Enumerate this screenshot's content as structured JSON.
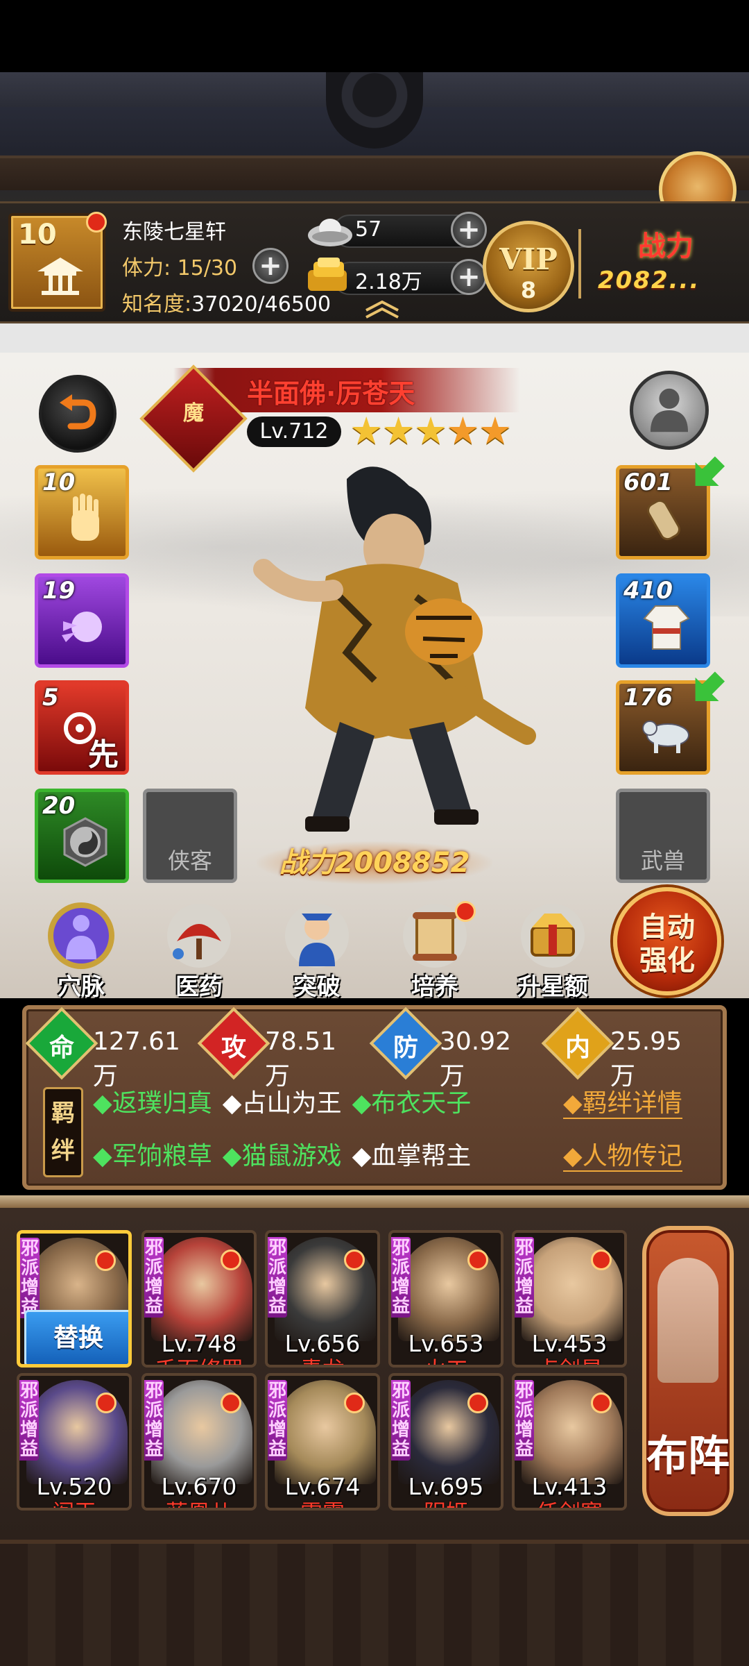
{
  "player": {
    "level": "10",
    "name": "东陵七星轩",
    "stamina_label": "体力: 15/30",
    "fame_label": "知名度:",
    "fame_value": "37020/46500",
    "silver": "57",
    "gold": "2.18万",
    "vip_text": "VIP",
    "vip_level": "8",
    "power_label": "战力",
    "power_value": "2082..."
  },
  "hero": {
    "name": "半面佛·厉苍天",
    "sect": "魔",
    "level": "Lv.712",
    "stars": 5,
    "power": "战力2008852"
  },
  "skills_left": [
    {
      "level": "10",
      "icon": "palm-icon",
      "color": "#c8871e"
    },
    {
      "level": "19",
      "icon": "fist-icon",
      "color": "#8b2ad6"
    },
    {
      "level": "5",
      "icon": "first-strike-icon",
      "color": "#c8231e",
      "mark": "先"
    },
    {
      "level": "20",
      "icon": "yin-yang-icon",
      "color": "#2f9a2a"
    }
  ],
  "empty_slot_left": "侠客",
  "equip_right": [
    {
      "level": "601",
      "icon": "bracer-icon",
      "color": "#c8871e"
    },
    {
      "level": "410",
      "icon": "robe-icon",
      "color": "#2a7ad6"
    },
    {
      "level": "176",
      "icon": "beast-icon",
      "color": "#c8871e"
    }
  ],
  "empty_slot_right": "武兽",
  "functions": [
    {
      "label": "穴脉",
      "icon": "meridian-icon"
    },
    {
      "label": "医药",
      "icon": "medicine-icon"
    },
    {
      "label": "突破",
      "icon": "breakthrough-icon"
    },
    {
      "label": "培养",
      "icon": "cultivate-icon"
    },
    {
      "label": "升星额外",
      "icon": "star-up-icon"
    }
  ],
  "auto_button": "自动\n强化",
  "stats": [
    {
      "icon": "命",
      "value": "127.61万",
      "color": "#19a83a"
    },
    {
      "icon": "攻",
      "value": "78.51万",
      "color": "#d22424"
    },
    {
      "icon": "防",
      "value": "30.92万",
      "color": "#2a7ed6"
    },
    {
      "icon": "内",
      "value": "25.95万",
      "color": "#e0a21a"
    }
  ],
  "bond_badge": "羁绊",
  "bonds_row1": [
    {
      "text": "返璞归真",
      "active": true
    },
    {
      "text": "占山为王",
      "active": false
    },
    {
      "text": "布衣天子",
      "active": true
    }
  ],
  "bonds_row2": [
    {
      "text": "军饷粮草",
      "active": true
    },
    {
      "text": "猫鼠游戏",
      "active": true
    },
    {
      "text": "血掌帮主",
      "active": false
    }
  ],
  "bond_detail_link": "羁绊详情",
  "biography_link": "人物传记",
  "team_tag": "邪派增益",
  "swap_button": "替换",
  "team": [
    {
      "level": "",
      "name": "",
      "selected": true,
      "face": "#8a6a4a"
    },
    {
      "level": "Lv.748",
      "name": "千面修罗",
      "face": "#b7433a"
    },
    {
      "level": "Lv.656",
      "name": "青龙",
      "face": "#3a3a3a"
    },
    {
      "level": "Lv.653",
      "name": "火工",
      "face": "#8a6a4a"
    },
    {
      "level": "Lv.453",
      "name": "卢剑星",
      "face": "#c7a27a"
    },
    {
      "level": "Lv.520",
      "name": "阎王",
      "face": "#5a4a8a"
    },
    {
      "level": "Lv.670",
      "name": "蓝凰儿",
      "face": "#9a9a9a"
    },
    {
      "level": "Lv.674",
      "name": "雷震",
      "face": "#a58a5a"
    },
    {
      "level": "Lv.695",
      "name": "阴姬",
      "face": "#2a2a3a"
    },
    {
      "level": "Lv.413",
      "name": "任剑寒",
      "face": "#a07a5a"
    }
  ],
  "formation_button": "布阵"
}
